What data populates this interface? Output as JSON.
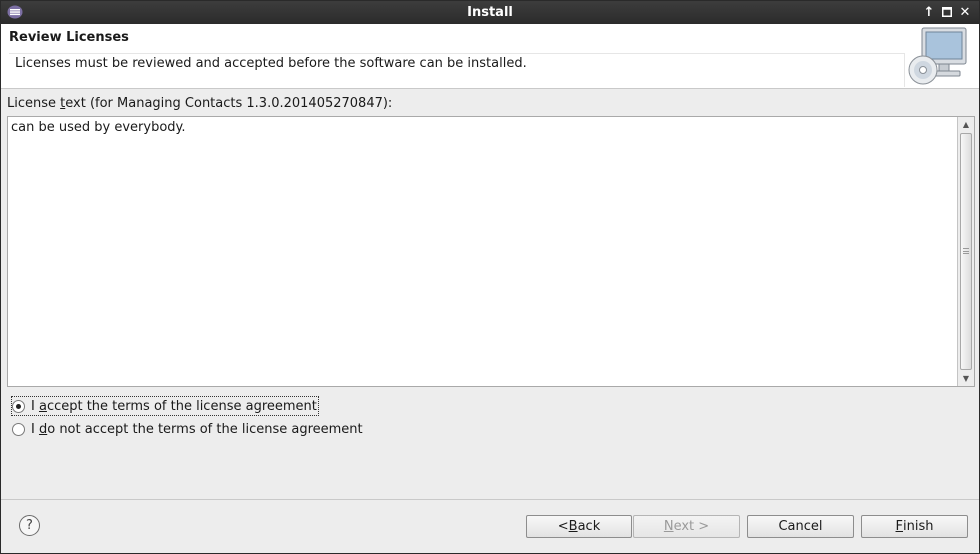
{
  "window": {
    "title": "Install",
    "controls": [
      "up-arrow-icon",
      "maximize-icon",
      "close-icon"
    ]
  },
  "header": {
    "title": "Review Licenses",
    "description": "Licenses must be reviewed and accepted before the software can be installed."
  },
  "license": {
    "label_pre": "License ",
    "label_mnemonic": "t",
    "label_post": "ext (for Managing Contacts 1.3.0.201405270847):",
    "text": "can be used by everybody."
  },
  "options": {
    "accept": {
      "pre": "I ",
      "mnemonic": "a",
      "post": "ccept the terms of the license agreement",
      "selected": true
    },
    "decline": {
      "pre": "I ",
      "mnemonic": "d",
      "post": "o not accept the terms of the license agreement",
      "selected": false
    }
  },
  "buttons": {
    "back": {
      "pre": "< ",
      "mnemonic": "B",
      "post": "ack"
    },
    "next": {
      "pre": "",
      "mnemonic": "N",
      "post": "ext >",
      "enabled": false
    },
    "cancel": "Cancel",
    "finish": {
      "pre": "",
      "mnemonic": "F",
      "post": "inish"
    },
    "help": "?"
  }
}
